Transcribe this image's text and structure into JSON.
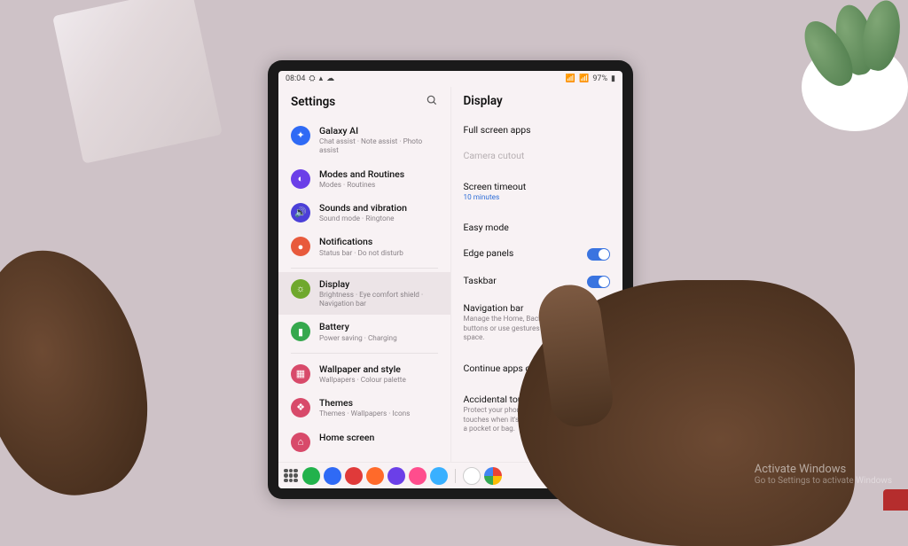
{
  "statusbar": {
    "time": "08:04",
    "battery_text": "97%"
  },
  "settings": {
    "title": "Settings",
    "items": [
      {
        "title": "Galaxy AI",
        "sub": "Chat assist · Note assist · Photo assist",
        "color": "#2f6af5",
        "glyph": "✦"
      },
      {
        "title": "Modes and Routines",
        "sub": "Modes · Routines",
        "color": "#6b3fe8",
        "glyph": "◐"
      },
      {
        "title": "Sounds and vibration",
        "sub": "Sound mode · Ringtone",
        "color": "#4b3fd8",
        "glyph": "🔊"
      },
      {
        "title": "Notifications",
        "sub": "Status bar · Do not disturb",
        "color": "#e85a3c",
        "glyph": "●"
      },
      {
        "title": "Display",
        "sub": "Brightness · Eye comfort shield · Navigation bar",
        "color": "#6fa82d",
        "glyph": "☼",
        "selected": true
      },
      {
        "title": "Battery",
        "sub": "Power saving · Charging",
        "color": "#35a84d",
        "glyph": "▮"
      },
      {
        "title": "Wallpaper and style",
        "sub": "Wallpapers · Colour palette",
        "color": "#d84a6a",
        "glyph": "▦"
      },
      {
        "title": "Themes",
        "sub": "Themes · Wallpapers · Icons",
        "color": "#d84a6a",
        "glyph": "❖"
      },
      {
        "title": "Home screen",
        "sub": "",
        "color": "#d84a6a",
        "glyph": "⌂"
      }
    ]
  },
  "display": {
    "title": "Display",
    "items": [
      {
        "kind": "link",
        "title": "Full screen apps"
      },
      {
        "kind": "disabled",
        "title": "Camera cutout"
      },
      {
        "kind": "gap"
      },
      {
        "kind": "value",
        "title": "Screen timeout",
        "value": "10 minutes"
      },
      {
        "kind": "gap"
      },
      {
        "kind": "link",
        "title": "Easy mode"
      },
      {
        "kind": "toggle",
        "title": "Edge panels",
        "on": true
      },
      {
        "kind": "toggle",
        "title": "Taskbar",
        "on": true
      },
      {
        "kind": "desc",
        "title": "Navigation bar",
        "sub": "Manage the Home, Back, and Recents buttons or use gestures for more screen space."
      },
      {
        "kind": "gap"
      },
      {
        "kind": "link",
        "title": "Continue apps on cover screen"
      },
      {
        "kind": "gap"
      },
      {
        "kind": "desc",
        "title": "Accidental touch protection",
        "sub": "Protect your phone from accidental touches when it's in a dark place, such as a pocket or bag."
      }
    ]
  },
  "taskbar": {
    "apps": [
      {
        "color": "#22b24c"
      },
      {
        "color": "#2f6af5"
      },
      {
        "color": "#e03a3a"
      },
      {
        "color": "#ff6a2a"
      },
      {
        "color": "#6b3fe8"
      },
      {
        "color": "#ff4d8d"
      },
      {
        "color": "#39b0ff"
      }
    ],
    "apps_right": [
      {
        "color": "#ffffff"
      },
      {
        "color": "linear"
      }
    ]
  },
  "watermark": {
    "line1": "Activate Windows",
    "line2": "Go to Settings to activate Windows"
  }
}
